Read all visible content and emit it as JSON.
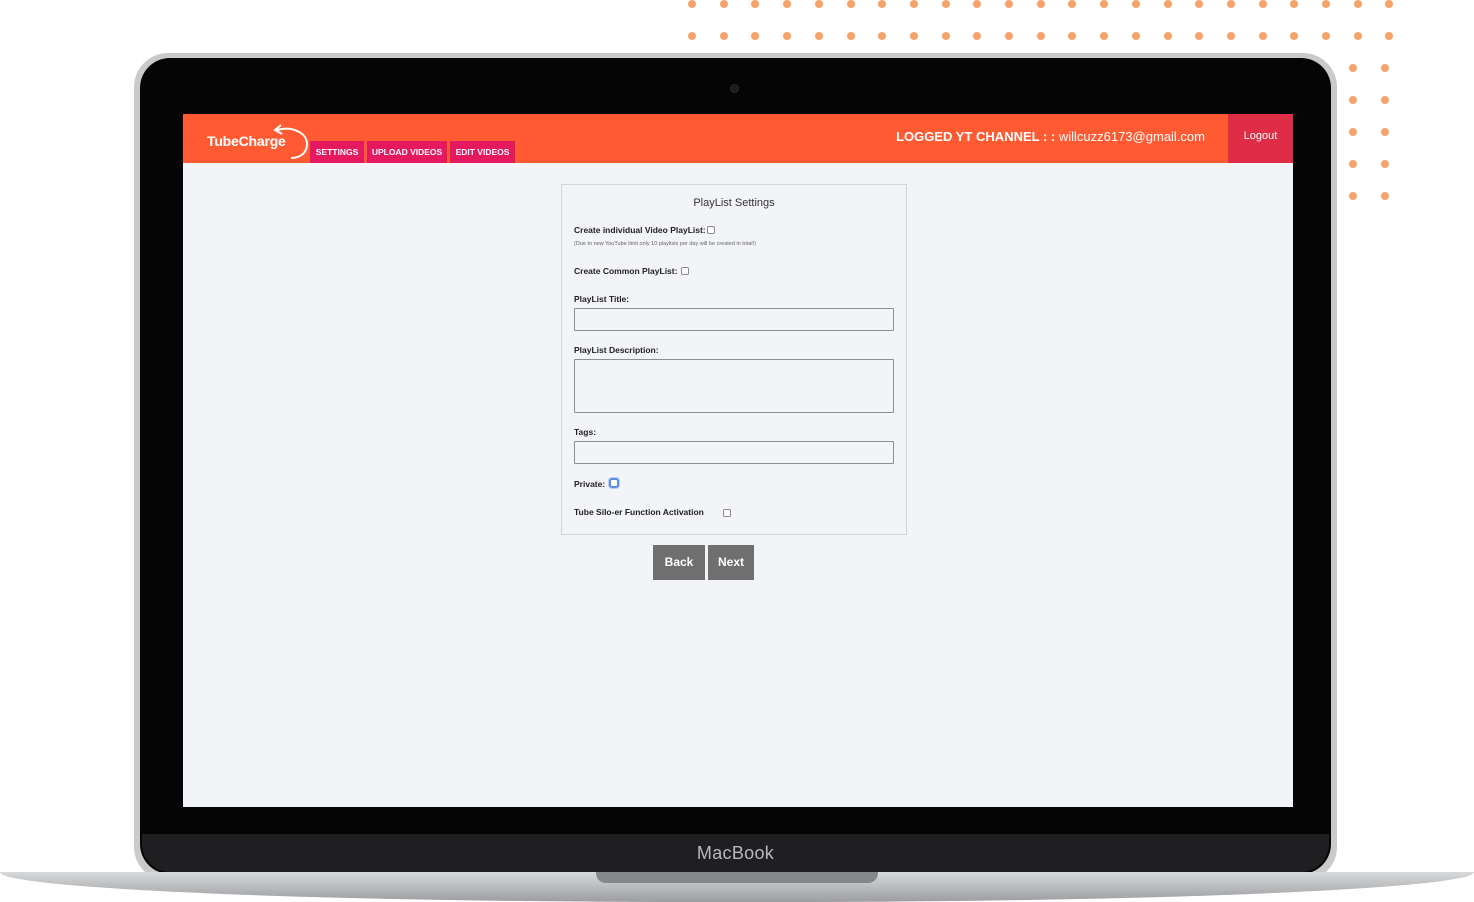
{
  "device": {
    "brand_label": "MacBook"
  },
  "app": {
    "logo_text": "TubeCharge",
    "nav": [
      {
        "label": "SETTINGS"
      },
      {
        "label": "UPLOAD VIDEOS"
      },
      {
        "label": "EDIT VIDEOS"
      }
    ],
    "logged_label": "LOGGED YT CHANNEL : :",
    "logged_email": "willcuzz6173@gmail.com",
    "logout_label": "Logout"
  },
  "form": {
    "title": "PlayList Settings",
    "individual_label": "Create individual Video PlayList:",
    "individual_hint": "(Due to new YouTube limit only 10 playlists per day will be created in total!)",
    "common_label": "Create Common PlayList:",
    "playlist_title_label": "PlayList Title:",
    "playlist_title_value": "",
    "playlist_description_label": "PlayList Description:",
    "playlist_description_value": "",
    "tags_label": "Tags:",
    "tags_value": "",
    "private_label": "Private:",
    "silo_label": "Tube Silo-er Function Activation",
    "checkboxes": {
      "individual": false,
      "common": false,
      "private": false,
      "silo": false
    }
  },
  "buttons": {
    "back": "Back",
    "next": "Next"
  },
  "colors": {
    "topbar": "#ff5a32",
    "nav_tab": "#e4195f",
    "logout": "#e02d46",
    "button": "#6f6f6f",
    "dots": "#f7a26a"
  }
}
